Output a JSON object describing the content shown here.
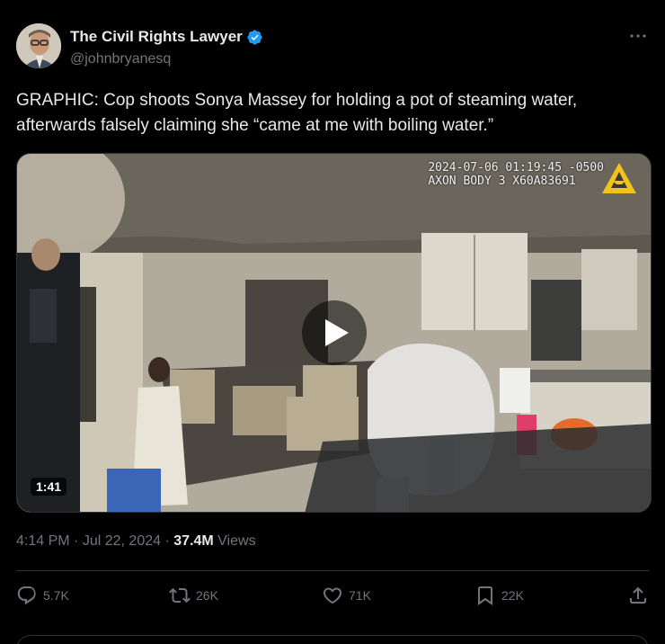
{
  "author": {
    "display_name": "The Civil Rights Lawyer",
    "handle": "@johnbryanesq",
    "verified": true,
    "verified_color": "#1d9bf0"
  },
  "more_icon": "more-horizontal-icon",
  "tweet": {
    "text": "GRAPHIC: Cop shoots Sonya Massey for holding a pot of steaming water, afterwards falsely claiming she “came at me with boiling water.”"
  },
  "media": {
    "overlay_line1": "2024-07-06 01:19:45 -0500",
    "overlay_line2": "AXON BODY 3 X60A83691",
    "duration": "1:41",
    "logo_color": "#f2c318"
  },
  "meta": {
    "time": "4:14 PM",
    "separator": "·",
    "date": "Jul 22, 2024",
    "views_count": "37.4M",
    "views_label": "Views"
  },
  "actions": {
    "replies": "5.7K",
    "retweets": "26K",
    "likes": "71K",
    "bookmarks": "22K"
  }
}
